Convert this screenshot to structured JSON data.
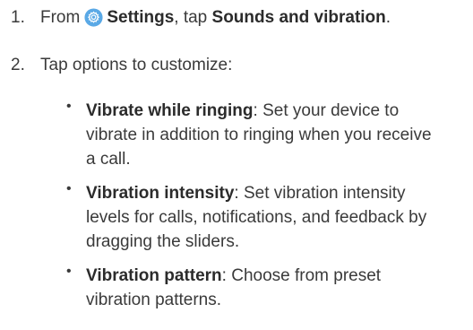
{
  "steps": [
    {
      "number": "1.",
      "prefix": "From",
      "settings_label": "Settings",
      "middle": ", tap ",
      "target_label": "Sounds and vibration",
      "end": ".",
      "icon": "settings-gear-icon",
      "icon_color": "#5aa9e6"
    },
    {
      "number": "2.",
      "text": "Tap options to customize:"
    }
  ],
  "options": [
    {
      "title": "Vibrate while ringing",
      "lines": [
        ": Set your device to",
        "vibrate in addition to ringing when you receive",
        "a call."
      ]
    },
    {
      "title": "Vibration intensity",
      "lines": [
        ": Set vibration intensity",
        "levels for calls, notifications, and feedback by",
        "dragging the sliders."
      ]
    },
    {
      "title": "Vibration pattern",
      "lines": [
        ": Choose from preset",
        "vibration patterns."
      ]
    }
  ],
  "bullet_symbol": "•"
}
